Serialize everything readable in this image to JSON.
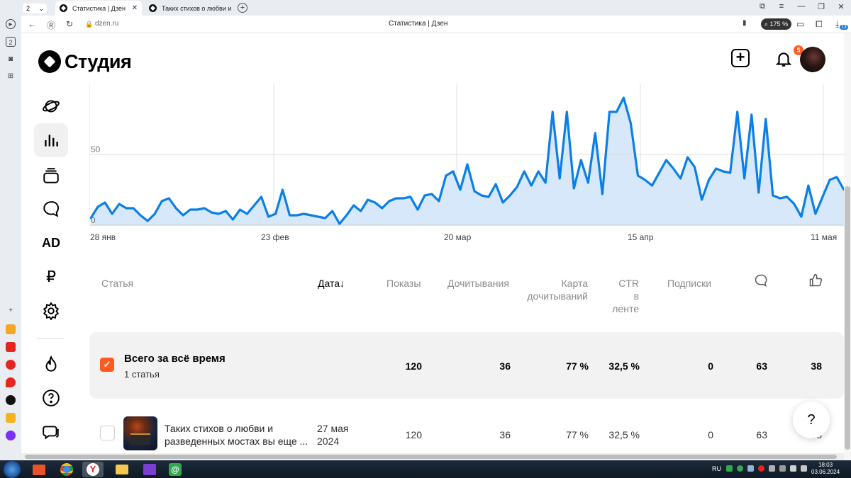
{
  "browser": {
    "tab_counter": "2",
    "tabs": [
      {
        "label": "Статистика | Дзен"
      },
      {
        "label": "Таких стихов о любви и р"
      }
    ],
    "url": "dzen.ru",
    "page_title": "Статистика | Дзен",
    "zoom": "175 %",
    "downloads_badge": "13"
  },
  "header": {
    "logo_text": "Студия",
    "notifications_count": "5"
  },
  "sidebar": {
    "items": [
      {
        "icon": "planet-icon"
      },
      {
        "icon": "stats-icon",
        "active": true
      },
      {
        "icon": "publications-icon"
      },
      {
        "icon": "comments-icon"
      },
      {
        "icon": "ad-icon",
        "label": "AD"
      },
      {
        "icon": "ruble-icon",
        "label": "₽"
      },
      {
        "icon": "settings-icon"
      },
      {
        "icon": "fire-icon"
      },
      {
        "icon": "help-icon"
      },
      {
        "icon": "chat-icon"
      }
    ]
  },
  "chart_data": {
    "type": "area",
    "y_tick_labels": [
      "50",
      "0"
    ],
    "x_tick_labels": [
      "28 янв",
      "23 фев",
      "20 мар",
      "15 апр",
      "11 мая"
    ],
    "ylim": [
      0,
      100
    ],
    "grid": true,
    "color": "#0b7fe8",
    "fill": "#d6e8fa",
    "values": [
      5,
      13,
      16,
      8,
      15,
      12,
      12,
      7,
      3,
      8,
      17,
      19,
      12,
      7,
      11,
      11,
      12,
      9,
      8,
      10,
      4,
      11,
      8,
      14,
      20,
      6,
      8,
      25,
      7,
      7,
      8,
      7,
      6,
      5,
      10,
      1,
      7,
      14,
      10,
      18,
      16,
      12,
      17,
      19,
      19,
      20,
      11,
      21,
      22,
      17,
      35,
      38,
      25,
      43,
      24,
      21,
      20,
      29,
      16,
      21,
      27,
      38,
      28,
      38,
      30,
      80,
      33,
      80,
      26,
      46,
      30,
      65,
      22,
      80,
      80,
      90,
      72,
      35,
      32,
      28,
      37,
      46,
      40,
      33,
      48,
      41,
      18,
      32,
      40,
      38,
      37,
      80,
      33,
      78,
      23,
      75,
      21,
      19,
      20,
      15,
      6,
      28,
      8,
      20,
      32,
      34,
      25
    ]
  },
  "table": {
    "headers": {
      "article": "Статья",
      "date": "Дата",
      "date_sort": "↓",
      "views": "Показы",
      "reads": "Дочитывания",
      "read_map_line1": "Карта",
      "read_map_line2": "дочитываний",
      "ctr_line1": "CTR",
      "ctr_line2": "в ленте",
      "subs": "Подписки"
    },
    "total": {
      "check": "✓",
      "title": "Всего за всё время",
      "subtitle": "1 статья",
      "views": "120",
      "reads": "36",
      "read_map": "77 %",
      "ctr": "32,5 %",
      "subs": "0",
      "comments": "63",
      "likes": "38"
    },
    "rows": [
      {
        "title": "Таких стихов о любви и разведенных мостах вы еще ...",
        "date_line1": "27 мая",
        "date_line2": "2024",
        "views": "120",
        "reads": "36",
        "read_map": "77 %",
        "ctr": "32,5 %",
        "subs": "0",
        "comments": "63",
        "likes": "38"
      }
    ]
  },
  "help_button": "?",
  "taskbar": {
    "lang": "RU",
    "time": "18:03",
    "date": "03.06.2024"
  }
}
